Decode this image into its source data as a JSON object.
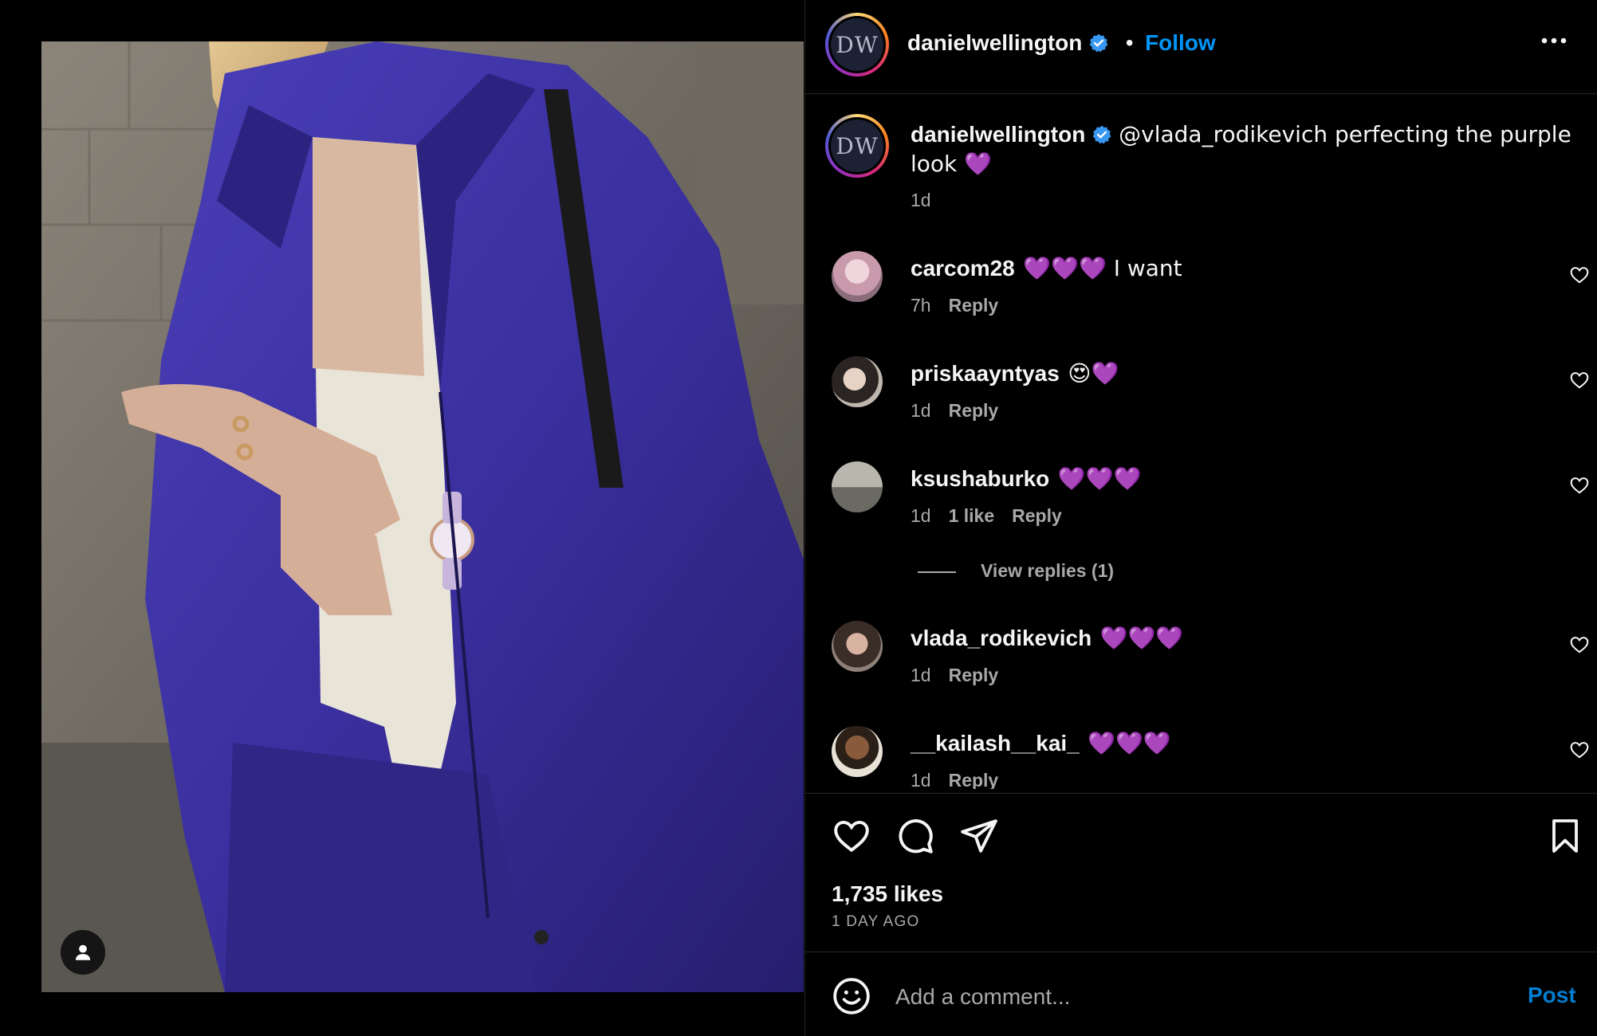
{
  "post": {
    "author": "danielwellington",
    "follow_label": "Follow",
    "separator": "•",
    "more_icon": "more-horizontal-icon",
    "avatar_logo": "DW"
  },
  "caption": {
    "author": "danielwellington",
    "text": "@vlada_rodikevich perfecting the purple look 💜",
    "time": "1d"
  },
  "comments": [
    {
      "user": "carcom28",
      "text": "💜💜💜 I want",
      "time": "7h",
      "likes": "",
      "reply": "Reply"
    },
    {
      "user": "priskaayntyas",
      "text": "😍💜",
      "time": "1d",
      "likes": "",
      "reply": "Reply"
    },
    {
      "user": "ksushaburko",
      "text": "💜💜💜",
      "time": "1d",
      "likes": "1 like",
      "reply": "Reply"
    },
    {
      "user": "vlada_rodikevich",
      "text": "💜💜💜",
      "time": "1d",
      "likes": "",
      "reply": "Reply"
    },
    {
      "user": "__kailash__kai_",
      "text": "💜💜💜",
      "time": "1d",
      "likes": "",
      "reply": "Reply"
    }
  ],
  "view_replies": "View replies (1)",
  "actions": {
    "likes": "1,735 likes",
    "time_ago": "1 DAY AGO"
  },
  "composer": {
    "placeholder": "Add a comment...",
    "post_label": "Post"
  },
  "colors": {
    "accent": "#0095f6",
    "background": "#000000",
    "secondary_text": "#a8a8a8",
    "heart_emoji": "#b53cf0"
  }
}
